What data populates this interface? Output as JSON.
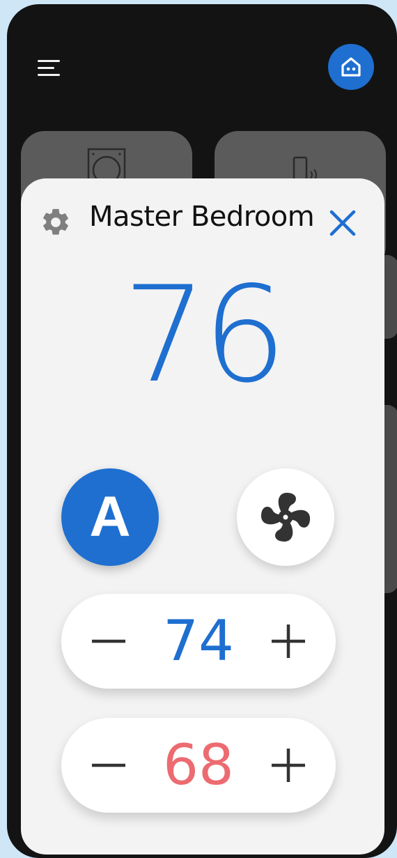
{
  "header": {
    "menu_icon": "menu-icon",
    "home_icon": "home-icon",
    "accent_color": "#1e6fd0"
  },
  "background_cards": {
    "left_icon": "thermostat-icon",
    "right_icon": "door-sensor-icon"
  },
  "dialog": {
    "settings_icon": "gear-icon",
    "title": "Master Bedroom",
    "close_icon": "close-icon",
    "current_temperature": "76",
    "mode_label": "A",
    "fan_icon": "fan-icon",
    "cool_setpoint": {
      "decrease_icon": "minus-icon",
      "value": "74",
      "increase_icon": "plus-icon",
      "color": "#1e6fd0"
    },
    "heat_setpoint": {
      "decrease_icon": "minus-icon",
      "value": "68",
      "increase_icon": "plus-icon",
      "color": "#ec6b71"
    }
  }
}
